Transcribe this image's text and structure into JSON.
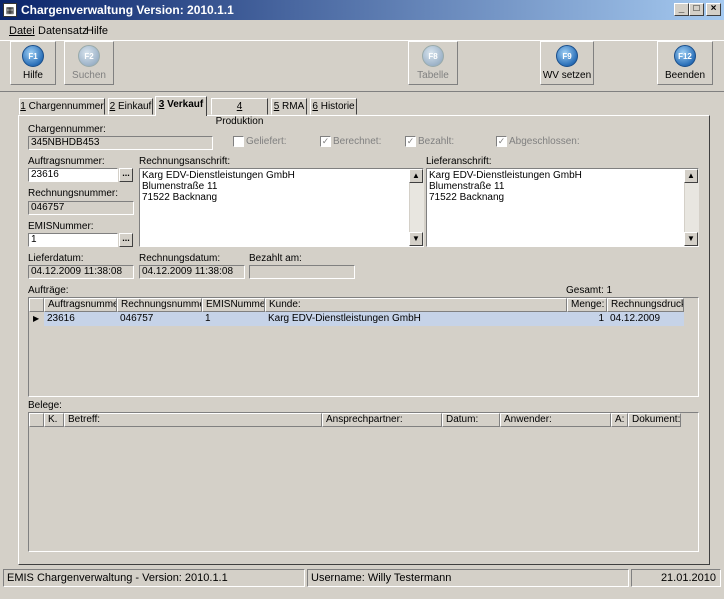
{
  "window": {
    "title": "Chargenverwaltung Version: 2010.1.1",
    "minimize": "_",
    "maximize": "□",
    "close": "×"
  },
  "menu": [
    "Datei",
    "Datensatz",
    "Hilfe"
  ],
  "toolbar": [
    {
      "key": "F1",
      "label": "Hilfe",
      "enabled": true
    },
    {
      "key": "F2",
      "label": "Suchen",
      "enabled": false
    },
    {
      "key": "F8",
      "label": "Tabelle",
      "enabled": false
    },
    {
      "key": "F9",
      "label": "WV setzen",
      "enabled": true
    },
    {
      "key": "F12",
      "label": "Beenden",
      "enabled": true
    }
  ],
  "tabs": [
    {
      "num": "1",
      "label": "Chargennummer"
    },
    {
      "num": "2",
      "label": "Einkauf"
    },
    {
      "num": "3",
      "label": "Verkauf"
    },
    {
      "num": "4",
      "label": "Produktion"
    },
    {
      "num": "5",
      "label": "RMA"
    },
    {
      "num": "6",
      "label": "Historie"
    }
  ],
  "active_tab": "3 Verkauf",
  "form": {
    "chargennummer_label": "Chargennummer:",
    "chargennummer": "345NBHDB453",
    "checkboxes": [
      {
        "label": "Geliefert:",
        "checked": false
      },
      {
        "label": "Berechnet:",
        "checked": true
      },
      {
        "label": "Bezahlt:",
        "checked": true
      },
      {
        "label": "Abgeschlossen:",
        "checked": true
      }
    ],
    "auftragsnummer_label": "Auftragsnummer:",
    "auftragsnummer": "23616",
    "rechnungsnummer_label": "Rechnungsnummer:",
    "rechnungsnummer": "046757",
    "emisnummer_label": "EMISNummer:",
    "emisnummer": "1",
    "dots": "...",
    "rechnungsanschrift_label": "Rechnungsanschrift:",
    "rechnungsanschrift": [
      "Karg EDV-Dienstleistungen GmbH",
      "Blumenstraße 11",
      "71522 Backnang"
    ],
    "lieferanschrift_label": "Lieferanschrift:",
    "lieferanschrift": [
      "Karg EDV-Dienstleistungen GmbH",
      "Blumenstraße 11",
      "71522 Backnang"
    ],
    "lieferdatum_label": "Lieferdatum:",
    "lieferdatum": "04.12.2009 11:38:08",
    "rechnungsdatum_label": "Rechnungsdatum:",
    "rechnungsdatum": "04.12.2009 11:38:08",
    "bezahlt_am_label": "Bezahlt am:",
    "bezahlt_am": ""
  },
  "auftraege": {
    "label": "Aufträge:",
    "gesamt": "Gesamt: 1",
    "columns": [
      "Auftragsnummer:",
      "Rechnungsnummer:",
      "EMISNummer:",
      "Kunde:",
      "Menge:",
      "Rechnungsdruck:"
    ],
    "rows": [
      [
        "23616",
        "046757",
        "1",
        "Karg EDV-Dienstleistungen GmbH",
        "1",
        "04.12.2009"
      ]
    ]
  },
  "belege": {
    "label": "Belege:",
    "columns": [
      "K.",
      "Betreff:",
      "Ansprechpartner:",
      "Datum:",
      "Anwender:",
      "A:",
      "Dokument:"
    ]
  },
  "statusbar": {
    "app": "EMIS Chargenverwaltung - Version: 2010.1.1",
    "user": "Username: Willy Testermann",
    "date": "21.01.2010"
  },
  "colors": {
    "titlebar_start": "#0a246a",
    "titlebar_end": "#a6caf0",
    "face": "#d4d0c8",
    "selected_row": "#c6d3e8"
  }
}
